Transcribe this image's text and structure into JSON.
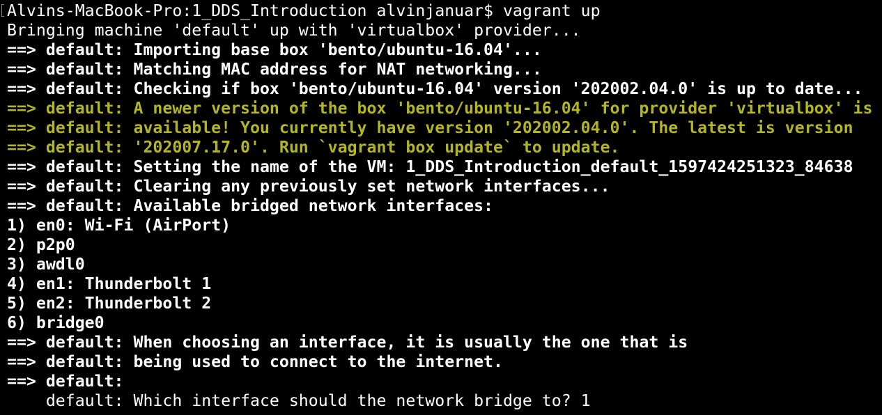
{
  "terminal": {
    "lines": [
      {
        "text": "Alvins-MacBook-Pro:1_DDS_Introduction alvinjanuar$ vagrant up",
        "style": "plain"
      },
      {
        "text": "Bringing machine 'default' up with 'virtualbox' provider...",
        "style": "plain"
      },
      {
        "text": "==> default: Importing base box 'bento/ubuntu-16.04'...",
        "style": "bold"
      },
      {
        "text": "==> default: Matching MAC address for NAT networking...",
        "style": "bold"
      },
      {
        "text": "==> default: Checking if box 'bento/ubuntu-16.04' version '202002.04.0' is up to date...",
        "style": "bold"
      },
      {
        "text": "==> default: A newer version of the box 'bento/ubuntu-16.04' for provider 'virtualbox' is",
        "style": "yellow"
      },
      {
        "text": "==> default: available! You currently have version '202002.04.0'. The latest is version",
        "style": "yellow"
      },
      {
        "text": "==> default: '202007.17.0'. Run `vagrant box update` to update.",
        "style": "yellow"
      },
      {
        "text": "==> default: Setting the name of the VM: 1_DDS_Introduction_default_1597424251323_84638",
        "style": "bold"
      },
      {
        "text": "==> default: Clearing any previously set network interfaces...",
        "style": "bold"
      },
      {
        "text": "==> default: Available bridged network interfaces:",
        "style": "bold"
      },
      {
        "text": "1) en0: Wi-Fi (AirPort)",
        "style": "bold"
      },
      {
        "text": "2) p2p0",
        "style": "bold"
      },
      {
        "text": "3) awdl0",
        "style": "bold"
      },
      {
        "text": "4) en1: Thunderbolt 1",
        "style": "bold"
      },
      {
        "text": "5) en2: Thunderbolt 2",
        "style": "bold"
      },
      {
        "text": "6) bridge0",
        "style": "bold"
      },
      {
        "text": "==> default: When choosing an interface, it is usually the one that is",
        "style": "bold"
      },
      {
        "text": "==> default: being used to connect to the internet.",
        "style": "bold"
      },
      {
        "text": "==> default:",
        "style": "bold"
      },
      {
        "text": "    default: Which interface should the network bridge to? 1",
        "style": "plain"
      }
    ]
  },
  "colors": {
    "background": "#000000",
    "foreground": "#ffffff",
    "warning": "#b3b524"
  }
}
